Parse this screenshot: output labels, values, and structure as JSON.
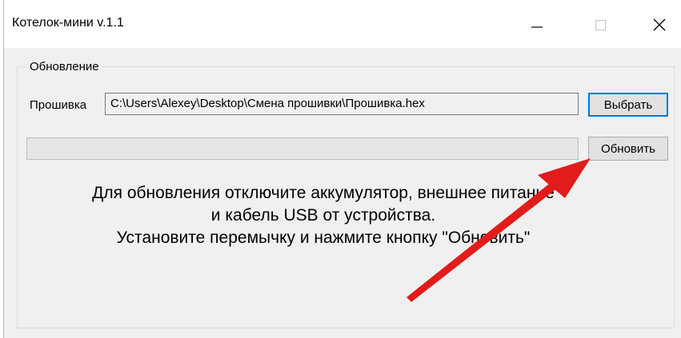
{
  "window": {
    "title": "Котелок-мини v.1.1",
    "controls": {
      "minimize": "—",
      "maximize": "☐",
      "close": "✕"
    }
  },
  "update_group": {
    "legend": "Обновление",
    "firmware_label": "Прошивка",
    "firmware_path": "C:\\Users\\Alexey\\Desktop\\Смена прошивки\\Прошивка.hex",
    "browse_button": "Выбрать",
    "update_button": "Обновить",
    "progress": 0,
    "instructions": {
      "line1": "Для обновления отключите аккумулятор, внешнее питание",
      "line2": "и кабель USB от устройства.",
      "line3": "Установите перемычку и нажмите кнопку \"Обновить\""
    }
  },
  "colors": {
    "window_bg": "#f0f0f0",
    "titlebar_bg": "#ffffff",
    "focus_border": "#0078d7",
    "annotation_arrow": "#e21b1b"
  }
}
